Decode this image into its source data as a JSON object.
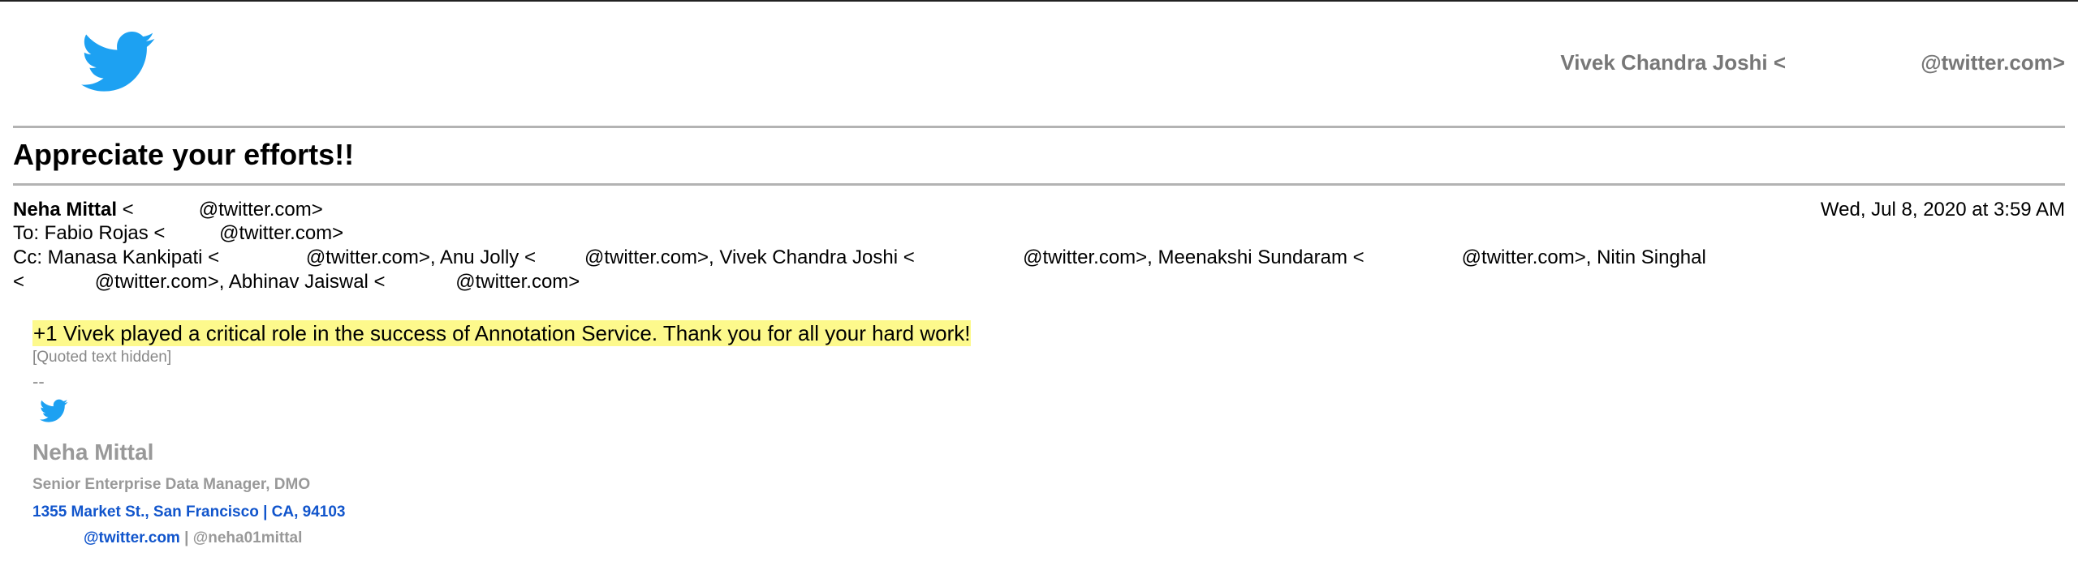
{
  "header": {
    "account": "Vivek Chandra Joshi <                       @twitter.com>"
  },
  "email": {
    "subject": "Appreciate your efforts!!",
    "from_name": "Neha Mittal",
    "from_address": " <            @twitter.com>",
    "date": "Wed, Jul 8, 2020 at 3:59 AM",
    "to": "To: Fabio Rojas <          @twitter.com>",
    "cc_line1": "Cc: Manasa Kankipati <                @twitter.com>, Anu Jolly <         @twitter.com>, Vivek Chandra Joshi <                    @twitter.com>, Meenakshi Sundaram <                  @twitter.com>, Nitin Singhal",
    "cc_line2": "<             @twitter.com>, Abhinav Jaiswal <             @twitter.com>",
    "body": "+1 Vivek played a critical role in the success of Annotation Service. Thank you for all your hard work!",
    "quoted_toggle": "[Quoted text hidden]",
    "signature_separator": "--"
  },
  "signature": {
    "name": "Neha Mittal",
    "title": "Senior Enterprise Data Manager, DMO",
    "address": "1355 Market St., San Francisco | CA, 94103",
    "email": "@twitter.com",
    "separator": " | ",
    "handle": "@neha01mittal"
  },
  "icons": {
    "logo": "twitter-bird-icon",
    "signature_logo": "twitter-bird-icon"
  },
  "colors": {
    "brand": "#1da1f2",
    "highlight": "#fdf98c",
    "link": "#1155cc",
    "muted": "#999999"
  }
}
